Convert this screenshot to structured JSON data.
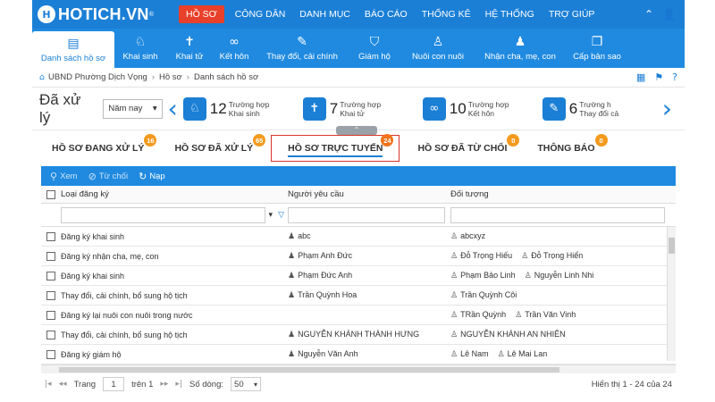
{
  "app": {
    "logo": "HOTICH.VN",
    "logo_mark": "H",
    "logo_sup": "®"
  },
  "topnav": [
    {
      "label": "HỒ SƠ",
      "active": true
    },
    {
      "label": "CÔNG DÂN"
    },
    {
      "label": "DANH MỤC"
    },
    {
      "label": "BÁO CÁO"
    },
    {
      "label": "THỐNG KÊ"
    },
    {
      "label": "HỆ THỐNG"
    },
    {
      "label": "TRỢ GIÚP"
    }
  ],
  "iconbar": [
    {
      "label": "Danh sách hồ sơ",
      "icon": "document-list-icon",
      "glyph": "▤",
      "active": true
    },
    {
      "label": "Khai sinh",
      "icon": "stroller-icon",
      "glyph": "♘"
    },
    {
      "label": "Khai tử",
      "icon": "mourning-icon",
      "glyph": "✝"
    },
    {
      "label": "Kết hôn",
      "icon": "rings-icon",
      "glyph": "∞"
    },
    {
      "label": "Thay đổi, cải chính",
      "icon": "edit-icon",
      "glyph": "✎"
    },
    {
      "label": "Giám hộ",
      "icon": "shield-icon",
      "glyph": "⛉"
    },
    {
      "label": "Nuôi con nuôi",
      "icon": "adopt-icon",
      "glyph": "♙"
    },
    {
      "label": "Nhận cha, mẹ, con",
      "icon": "family-icon",
      "glyph": "♟"
    },
    {
      "label": "Cấp bản sao",
      "icon": "copy-icon",
      "glyph": "❐"
    }
  ],
  "breadcrumb": [
    "UBND Phường Dịch Vọng",
    "Hồ sơ",
    "Danh sách hồ sơ"
  ],
  "summary": {
    "title": "Đã xử lý",
    "period": "Năm nay",
    "stats": [
      {
        "count": "12",
        "unit": "Trường hợp",
        "label": "Khai sinh",
        "icon": "stroller-icon",
        "glyph": "♘"
      },
      {
        "count": "7",
        "unit": "Trường hợp",
        "label": "Khai tử",
        "icon": "mourning-icon",
        "glyph": "✝"
      },
      {
        "count": "10",
        "unit": "Trường hợp",
        "label": "Kết hôn",
        "icon": "rings-icon",
        "glyph": "∞"
      },
      {
        "count": "6",
        "unit": "Trường h",
        "label": "Thay đổi cả",
        "icon": "edit-icon",
        "glyph": "✎"
      }
    ]
  },
  "tabs": [
    {
      "label": "HỒ SƠ ĐANG XỬ LÝ",
      "badge": "16"
    },
    {
      "label": "HỒ SƠ ĐÃ XỬ LÝ",
      "badge": "65"
    },
    {
      "label": "HỒ SƠ TRỰC TUYẾN",
      "badge": "24",
      "active": true
    },
    {
      "label": "HỒ SƠ ĐÃ TỪ CHỐI",
      "badge": "0"
    },
    {
      "label": "THÔNG BÁO",
      "badge": "0"
    }
  ],
  "actions": [
    {
      "label": "Xem",
      "icon": "search-icon",
      "glyph": "⚲"
    },
    {
      "label": "Từ chối",
      "icon": "ban-icon",
      "glyph": "⊘"
    },
    {
      "label": "Nạp",
      "icon": "refresh-icon",
      "glyph": "↻",
      "enabled": true
    }
  ],
  "table": {
    "columns": [
      "Loại đăng ký",
      "Người yêu cầu",
      "Đối tượng"
    ],
    "rows": [
      {
        "type": "Đăng ký khai sinh",
        "requester": "abc",
        "subjects": [
          "abcxyz"
        ]
      },
      {
        "type": "Đăng ký nhận cha, mẹ, con",
        "requester": "Phạm Anh Đức",
        "subjects": [
          "Đỗ Trọng Hiếu",
          "Đỗ Trọng Hiển"
        ]
      },
      {
        "type": "Đăng ký khai sinh",
        "requester": "Phạm Đức Anh",
        "subjects": [
          "Phạm Bảo Linh",
          "Nguyễn Linh Nhi"
        ]
      },
      {
        "type": "Thay đổi, cải chính, bổ sung hộ tịch",
        "requester": "Trần Quỳnh Hoa",
        "subjects": [
          "Trần Quỳnh Côi"
        ]
      },
      {
        "type": "Đăng ký lại nuôi con nuôi trong nước",
        "requester": "",
        "subjects": [
          "TRần Quỳnh",
          "Trần Văn Vinh"
        ]
      },
      {
        "type": "Thay đổi, cải chính, bổ sung hộ tịch",
        "requester": "NGUYỄN KHÁNH THÀNH HƯNG",
        "subjects": [
          "NGUYỄN KHÁNH AN NHIÊN"
        ]
      },
      {
        "type": "Đăng ký giám hộ",
        "requester": "Nguyễn Văn Anh",
        "subjects": [
          "Lê Nam",
          "Lê Mai Lan"
        ]
      }
    ]
  },
  "pager": {
    "page_label": "Trang",
    "page": "1",
    "of_label": "trên 1",
    "rows_label": "Số dòng:",
    "rows_value": "50",
    "info": "Hiển thị 1 - 24 của 24"
  }
}
